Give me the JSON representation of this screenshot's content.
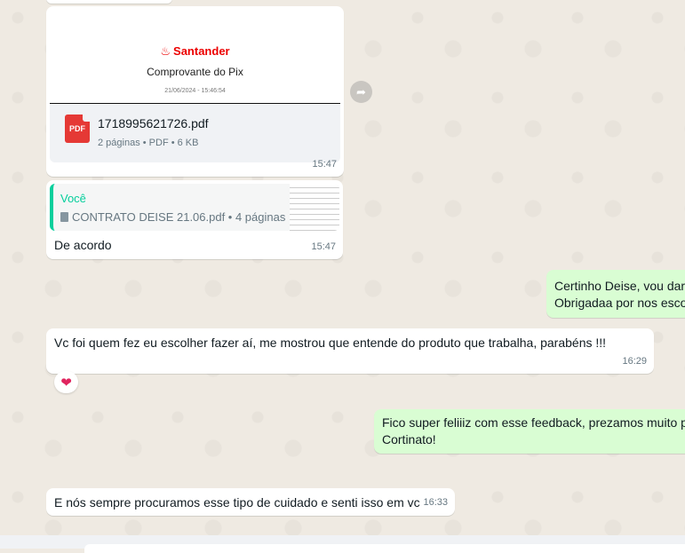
{
  "chat": {
    "pdf_message": {
      "brand": "Santander",
      "doc_title": "Comprovante do Pix",
      "doc_date": "21/06/2024 - 15:46:54",
      "file_name": "1718995621726.pdf",
      "file_meta": "2 páginas • PDF • 6 KB",
      "icon_label": "PDF",
      "time": "15:47"
    },
    "reply_message": {
      "quote_author": "Você",
      "quote_file": "CONTRATO DEISE 21.06.pdf • 4 páginas",
      "text": "De acordo",
      "time": "15:47"
    },
    "outgoing_1": {
      "line1": "Certinho Deise, vou dar",
      "line2": "Obrigadaa por nos esco"
    },
    "incoming_2": {
      "text": "Vc foi quem fez eu escolher fazer aí,  me mostrou que entende do produto que trabalha,  parabéns !!!",
      "time": "16:29",
      "reaction": "❤"
    },
    "outgoing_2": {
      "line1": "Fico super feliiiz com esse feedback, prezamos muito p",
      "line2": "Cortinato!"
    },
    "incoming_3": {
      "text": "E nós sempre procuramos esse tipo de cuidado e senti isso em vc",
      "time": "16:33"
    }
  },
  "colors": {
    "background": "#efeae2",
    "incoming_bubble": "#ffffff",
    "outgoing_bubble": "#d9fdd3",
    "accent": "#06cf9c",
    "santander_red": "#ec0000"
  }
}
